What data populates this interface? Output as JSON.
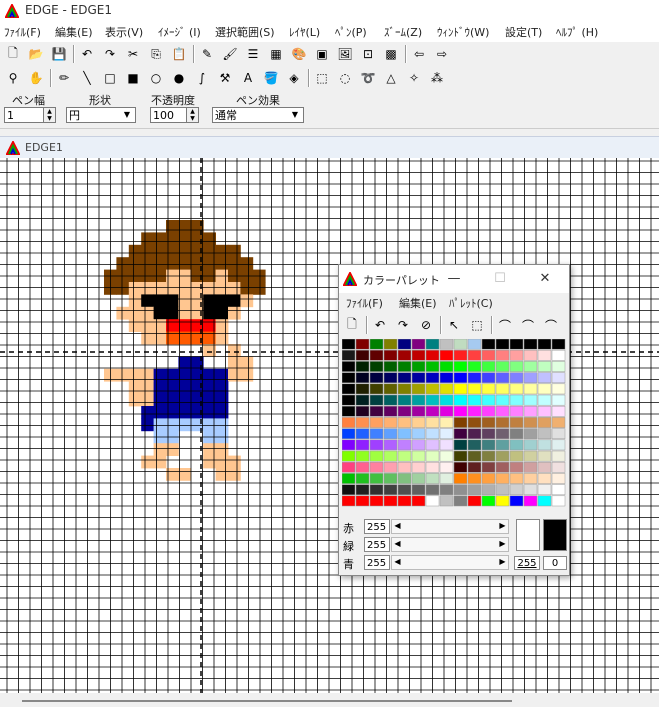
{
  "window": {
    "title": "EDGE - EDGE1"
  },
  "menubar": {
    "items": [
      "ﾌｧｲﾙ(F)",
      "編集(E)",
      "表示(V)",
      "ｲﾒｰｼﾞ (I)",
      "選択範囲(S)",
      "ﾚｲﾔ(L)",
      "ﾍﾟﾝ(P)",
      "ｽﾞｰﾑ(Z)",
      "ｳｨﾝﾄﾞｳ(W)",
      "設定(T)",
      "ﾍﾙﾌﾟ (H)"
    ]
  },
  "toolbar1": {
    "icons": [
      "new-icon",
      "open-icon",
      "save-icon",
      "undo-icon",
      "redo-icon",
      "cut-icon",
      "copy-icon",
      "paste-icon",
      "pen-tool-icon",
      "brush-tool-icon",
      "line-style-icon",
      "pattern-icon",
      "palette-icon",
      "film-icon",
      "image-icon",
      "frame-icon",
      "grid-icon",
      "back-icon",
      "forward-icon"
    ]
  },
  "toolbar2": {
    "icons": [
      "zoom-icon",
      "hand-icon",
      "pencil-icon",
      "line-icon",
      "rect-icon",
      "fill-rect-icon",
      "ellipse-icon",
      "fill-ellipse-icon",
      "curve-icon",
      "hammer-icon",
      "text-icon",
      "bucket-icon",
      "color-picker-icon",
      "rect-select-icon",
      "ellipse-select-icon",
      "lasso-icon",
      "poly-select-icon",
      "magic-select-icon",
      "scatter-select-icon"
    ]
  },
  "props": {
    "pen_width_label": "ペン幅",
    "pen_width_value": "1",
    "shape_label": "形状",
    "shape_value": "円",
    "opacity_label": "不透明度",
    "opacity_value": "100",
    "effect_label": "ペン効果",
    "effect_value": "通常"
  },
  "document": {
    "tab_title": "EDGE1"
  },
  "canvas": {
    "grid_color": "#000000",
    "guide_color": "#000000",
    "bg": "#ffffff"
  },
  "sprite": {
    "palette": {
      "H": "#7a4000",
      "S": "#ffc690",
      "K": "#000000",
      "R": "#ff0000",
      "O": "#ff5a00",
      "B": "#000099",
      "L": "#a8ccff"
    },
    "rows": [
      ".....HHH.....",
      "...HHHHHH....",
      "..HHHHHHHHH..",
      ".HHHHHHHHHHH.",
      "HHHHHSSHHSHHH",
      "HHSSSSSSSSSHH",
      "..SKKKSSKKKS.",
      ".SSSKKSSKKS..",
      "..SSSRRRRS...",
      "...SSOOOOS...",
      "........S.S..",
      "......BB..SS.",
      "SSSSBBBBBBSS.",
      "..SSBBBBBB...",
      "..SSBBBBBB...",
      "...BBBBBBB...",
      "...BLLLLLL...",
      "....LL..LL...",
      "....SS..SS...",
      "...SS...SSS..",
      ".....SS..SS.."
    ]
  },
  "palette_window": {
    "title": "カラーパレット",
    "menu": [
      "ﾌｧｲﾙ(F)",
      "編集(E)",
      "ﾊﾟﾚｯﾄ(C)"
    ],
    "tools": [
      "page-icon",
      "undo-icon",
      "redo-icon",
      "swap-icon",
      "arrow-icon",
      "select-icon",
      "bridge1-icon",
      "bridge2-icon",
      "bridge3-icon"
    ],
    "rows": [
      [
        "#000000",
        "#800000",
        "#008000",
        "#808000",
        "#000080",
        "#800080",
        "#008080",
        "#c0c0c0",
        "#c0dcc0",
        "#a6caf0",
        "#000000",
        "#000000",
        "#000000",
        "#000000",
        "#000000",
        "#000000"
      ],
      [
        "#1a1a1a",
        "#400000",
        "#600000",
        "#800000",
        "#a00000",
        "#c00000",
        "#e00000",
        "#ff0000",
        "#ff2020",
        "#ff4040",
        "#ff6060",
        "#ff8080",
        "#ffa0a0",
        "#ffc0c0",
        "#ffe0e0",
        "#ffffff"
      ],
      [
        "#000000",
        "#002000",
        "#004000",
        "#006000",
        "#008000",
        "#00a000",
        "#00c000",
        "#00e000",
        "#00ff00",
        "#20ff20",
        "#40ff40",
        "#60ff60",
        "#80ff80",
        "#a0ffa0",
        "#c0ffc0",
        "#e0ffe0"
      ],
      [
        "#000000",
        "#000020",
        "#000040",
        "#000060",
        "#000080",
        "#0000a0",
        "#0000c0",
        "#0000e0",
        "#0000ff",
        "#2020ff",
        "#4040ff",
        "#6060ff",
        "#8080ff",
        "#a0a0ff",
        "#c0c0ff",
        "#e0e0ff"
      ],
      [
        "#000000",
        "#202000",
        "#404000",
        "#606000",
        "#808000",
        "#a0a000",
        "#c0c000",
        "#e0e000",
        "#ffff00",
        "#ffff20",
        "#ffff40",
        "#ffff60",
        "#ffff80",
        "#ffffa0",
        "#ffffc0",
        "#ffffe0"
      ],
      [
        "#000000",
        "#002020",
        "#004040",
        "#006060",
        "#008080",
        "#00a0a0",
        "#00c0c0",
        "#00e0e0",
        "#00ffff",
        "#20ffff",
        "#40ffff",
        "#60ffff",
        "#80ffff",
        "#a0ffff",
        "#c0ffff",
        "#e0ffff"
      ],
      [
        "#000000",
        "#200020",
        "#400040",
        "#600060",
        "#800080",
        "#a000a0",
        "#c000c0",
        "#e000e0",
        "#ff00ff",
        "#ff20ff",
        "#ff40ff",
        "#ff60ff",
        "#ff80ff",
        "#ffa0ff",
        "#ffc0ff",
        "#ffe0ff"
      ],
      [
        "#ff8040",
        "#ff9050",
        "#ffa060",
        "#ffb070",
        "#ffc080",
        "#ffd090",
        "#ffe0a0",
        "#fff0b0",
        "#804000",
        "#905010",
        "#a06020",
        "#b07030",
        "#c08040",
        "#d09050",
        "#e0a060",
        "#f0b070"
      ],
      [
        "#0040ff",
        "#2060ff",
        "#4080ff",
        "#60a0ff",
        "#80c0ff",
        "#a0d0ff",
        "#c0e0ff",
        "#e0f0ff",
        "#400040",
        "#502050",
        "#604060",
        "#706070",
        "#808080",
        "#a0a0a0",
        "#c0c0c0",
        "#e0e0e0"
      ],
      [
        "#8000ff",
        "#9020ff",
        "#a040ff",
        "#b060ff",
        "#c080ff",
        "#d0a0ff",
        "#e0c0ff",
        "#f0e0ff",
        "#004040",
        "#206060",
        "#408080",
        "#60a0a0",
        "#80c0c0",
        "#a0d0d0",
        "#c0e0e0",
        "#e0f0f0"
      ],
      [
        "#80ff00",
        "#90ff20",
        "#a0ff40",
        "#b0ff60",
        "#c0ff80",
        "#d0ffa0",
        "#e0ffc0",
        "#f0ffe0",
        "#404000",
        "#606020",
        "#808040",
        "#a0a060",
        "#c0c080",
        "#d0d0a0",
        "#e0e0c0",
        "#f0f0e0"
      ],
      [
        "#ff4080",
        "#ff6090",
        "#ff80a0",
        "#ffa0b0",
        "#ffc0c0",
        "#ffd0d0",
        "#ffe0e0",
        "#fff0f0",
        "#400000",
        "#602020",
        "#804040",
        "#a06060",
        "#c08080",
        "#d0a0a0",
        "#e0c0c0",
        "#f0e0e0"
      ],
      [
        "#00c000",
        "#20c020",
        "#40c040",
        "#60c060",
        "#80c080",
        "#a0d0a0",
        "#c0e0c0",
        "#e0f0e0",
        "#ff8000",
        "#ff9020",
        "#ffa040",
        "#ffb060",
        "#ffc080",
        "#ffd0a0",
        "#ffe0c0",
        "#fff0e0"
      ],
      [
        "#101010",
        "#202020",
        "#303030",
        "#404040",
        "#505050",
        "#606060",
        "#707070",
        "#808080",
        "#909090",
        "#a0a0a0",
        "#b0b0b0",
        "#c0c0c0",
        "#d0d0d0",
        "#e0e0e0",
        "#f0f0f0",
        "#ffffff"
      ],
      [
        "#ff0000",
        "#ff0000",
        "#ff0000",
        "#ff0000",
        "#ff0000",
        "#ff0000",
        "#ffffff",
        "#c0c0c0",
        "#808080",
        "#ff0000",
        "#00ff00",
        "#ffff00",
        "#0000ff",
        "#ff00ff",
        "#00ffff",
        "#ffffff"
      ]
    ],
    "rgb": [
      {
        "label": "赤",
        "value": "255"
      },
      {
        "label": "緑",
        "value": "255"
      },
      {
        "label": "青",
        "value": "255"
      }
    ],
    "fg_color": "#ffffff",
    "bg_color": "#000000",
    "fg_value": "255",
    "bg_value": "0"
  }
}
